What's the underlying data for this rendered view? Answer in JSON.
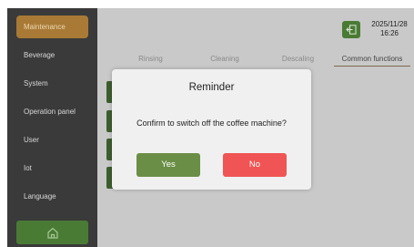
{
  "sidebar": {
    "items": [
      {
        "label": "Maintenance",
        "active": true
      },
      {
        "label": "Beverage"
      },
      {
        "label": "System"
      },
      {
        "label": "Operation panel"
      },
      {
        "label": "User"
      },
      {
        "label": "Iot"
      },
      {
        "label": "Language"
      }
    ],
    "home_icon": "home-icon"
  },
  "header": {
    "exit_icon": "exit-icon",
    "date": "2025/11/28",
    "time": "16:26"
  },
  "tabs": [
    {
      "label": "Rinsing"
    },
    {
      "label": "Cleaning"
    },
    {
      "label": "Descaling"
    },
    {
      "label": "Common functions",
      "active": true
    }
  ],
  "dialog": {
    "title": "Reminder",
    "message": "Confirm to switch off the coffee machine?",
    "yes_label": "Yes",
    "no_label": "No"
  },
  "colors": {
    "accent_active": "#a97a35",
    "green": "#4a7b35",
    "yes": "#6a8e45",
    "no": "#f05454"
  }
}
